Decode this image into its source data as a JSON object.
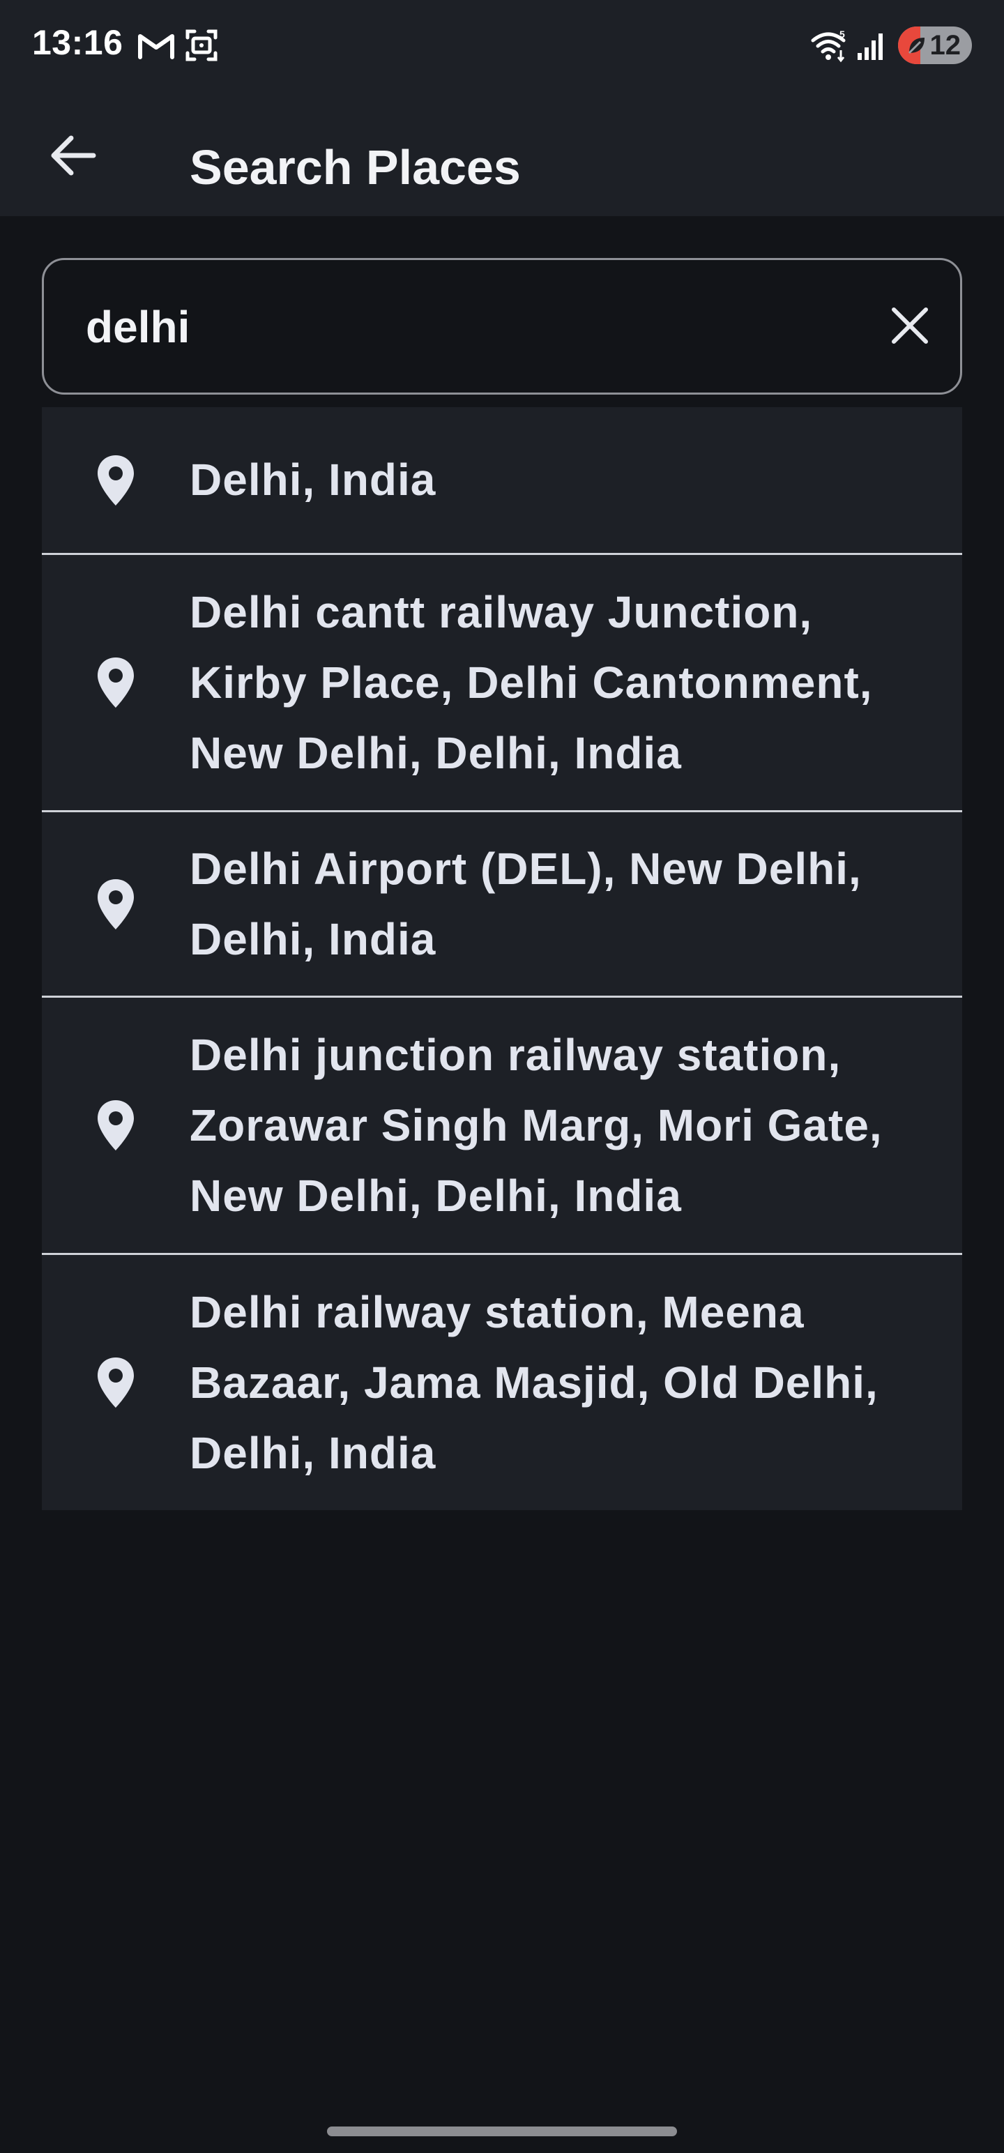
{
  "status_bar": {
    "time": "13:16",
    "battery": "12",
    "icons": [
      "gmail-icon",
      "screenshot-icon",
      "wifi-icon",
      "signal-icon",
      "battery-saver-icon"
    ]
  },
  "app_bar": {
    "title": "Search Places",
    "back_icon": "arrow-left-icon"
  },
  "search": {
    "value": "delhi",
    "clear_icon": "close-icon"
  },
  "results": [
    {
      "label": "Delhi, India"
    },
    {
      "label": "Delhi cantt railway Junction, Kirby Place, Delhi Cantonment, New Delhi, Delhi, India"
    },
    {
      "label": "Delhi Airport (DEL), New Delhi, Delhi, India"
    },
    {
      "label": "Delhi junction railway station, Zorawar Singh Marg, Mori Gate, New Delhi, Delhi, India"
    },
    {
      "label": "Delhi railway station, Meena Bazaar, Jama Masjid, Old Delhi, Delhi, India"
    }
  ],
  "colors": {
    "background": "#121418",
    "surface": "#1d2026",
    "text": "#e2e5ee",
    "divider": "#cfd2d8",
    "battery_low": "#e8483c"
  }
}
